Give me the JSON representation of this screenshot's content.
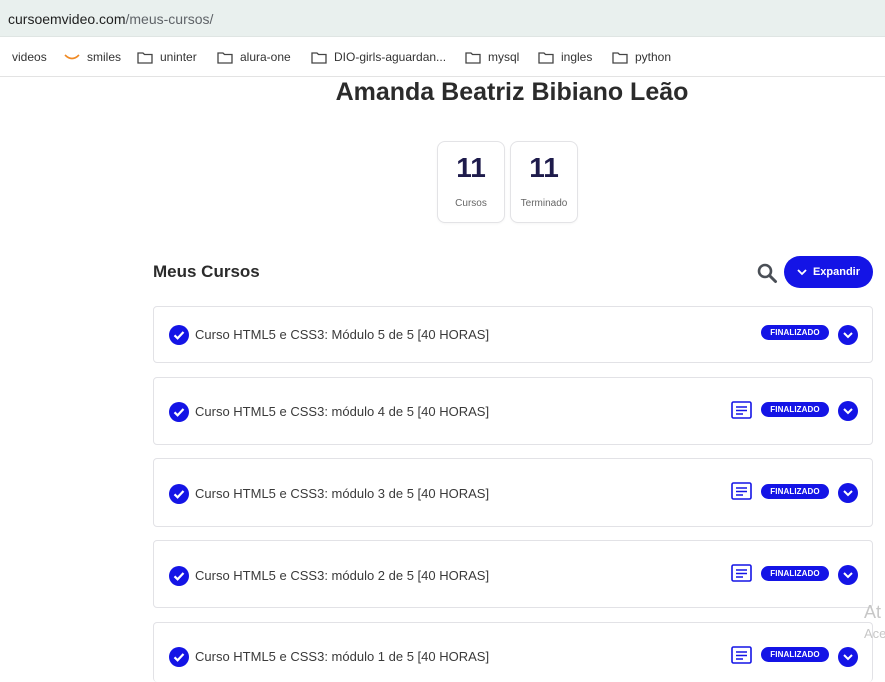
{
  "browser": {
    "url_host": "cursoemvideo.com",
    "url_path": "/meus-cursos/"
  },
  "bookmarks": [
    {
      "label": "videos",
      "icon": "folder-icon"
    },
    {
      "label": "smiles",
      "icon": "smile-icon"
    },
    {
      "label": "uninter",
      "icon": "folder-icon"
    },
    {
      "label": "alura-one",
      "icon": "folder-icon"
    },
    {
      "label": "DIO-girls-aguardan...",
      "icon": "folder-icon"
    },
    {
      "label": "mysql",
      "icon": "folder-icon"
    },
    {
      "label": "ingles",
      "icon": "folder-icon"
    },
    {
      "label": "python",
      "icon": "folder-icon"
    }
  ],
  "profile": {
    "name": "Amanda Beatriz Bibiano Leão",
    "stats": [
      {
        "value": "11",
        "label": "Cursos"
      },
      {
        "value": "11",
        "label": "Terminado"
      }
    ]
  },
  "courses_section": {
    "title": "Meus Cursos",
    "expand_label": "Expandir",
    "courses": [
      {
        "title": "Curso HTML5 e CSS3: Módulo 5 de 5 [40 HORAS]",
        "status": "FINALIZADO",
        "has_certificate": false
      },
      {
        "title": "Curso HTML5 e CSS3: módulo 4 de 5 [40 HORAS]",
        "status": "FINALIZADO",
        "has_certificate": true
      },
      {
        "title": "Curso HTML5 e CSS3: módulo 3 de 5 [40 HORAS]",
        "status": "FINALIZADO",
        "has_certificate": true
      },
      {
        "title": "Curso HTML5 e CSS3: módulo 2 de 5 [40 HORAS]",
        "status": "FINALIZADO",
        "has_certificate": true
      },
      {
        "title": "Curso HTML5 e CSS3: módulo 1 de 5 [40 HORAS]",
        "status": "FINALIZADO",
        "has_certificate": true
      }
    ]
  },
  "watermark": {
    "line1": "At",
    "line2": "Ace"
  },
  "colors": {
    "accent": "#1414e6",
    "address_bar": "#e9f0ee"
  }
}
